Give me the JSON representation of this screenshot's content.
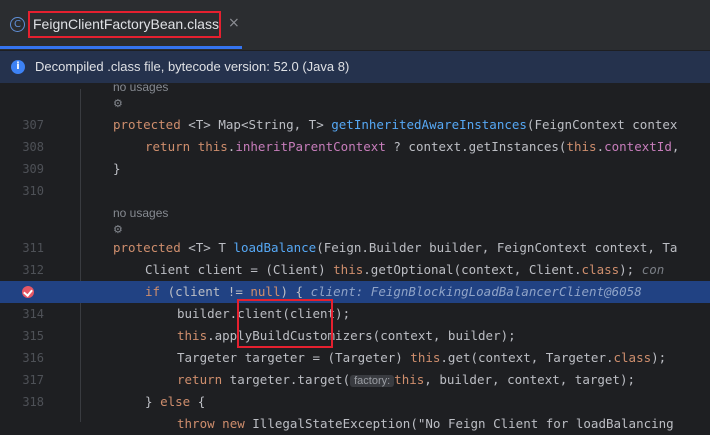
{
  "tab": {
    "icon": "class-icon",
    "title": "FeignClientFactoryBean.class",
    "close": "×"
  },
  "banner": {
    "icon": "info-icon",
    "text": "Decompiled .class file, bytecode version: 52.0 (Java 8)"
  },
  "editor": {
    "hints": {
      "usages1": "no usages",
      "usages2": "no usages"
    },
    "lines": {
      "l307": {
        "num": "307",
        "kw": "protected",
        "rest": " <T> Map<String, T> ",
        "fn": "getInheritedAwareInstances",
        "tail": "(FeignContext contex"
      },
      "l308": {
        "num": "308",
        "kw1": "return",
        "this1": "this",
        "p1": ".",
        "fld1": "inheritParentContext",
        "p2": " ? context.getInstances(",
        "this2": "this",
        "p3": ".",
        "fld2": "contextId",
        "p4": ","
      },
      "l309": {
        "num": "309",
        "text": "}"
      },
      "l310": {
        "num": "310"
      },
      "l311": {
        "num": "311",
        "kw": "protected",
        "rest": " <T> T ",
        "fn": "loadBalance",
        "tail": "(Feign.Builder builder, FeignContext context, Ta"
      },
      "l312": {
        "num": "312",
        "pre": "Client client = (Client) ",
        "this": "this",
        "mid": ".getOptional(context, Client.",
        "cls": "class",
        "end": ");",
        "inl": "con"
      },
      "l313": {
        "kw1": "if",
        "mid": " (client != ",
        "kw2": "null",
        "end": ") {",
        "inl": "client: FeignBlockingLoadBalancerClient@6058"
      },
      "l314": {
        "num": "314",
        "text": "builder.client(client);"
      },
      "l315": {
        "num": "315",
        "this": "this",
        "rest": ".applyBuildCustomizers(context, builder);"
      },
      "l316": {
        "num": "316",
        "pre": "Targeter targeter = (Targeter) ",
        "this": "this",
        "mid": ".get(context, Targeter.",
        "cls": "class",
        "end": ");"
      },
      "l317": {
        "num": "317",
        "kw": "return",
        "mid": " targeter.target(",
        "param": "factory:",
        "this": "this",
        "end": ", builder, context, target);"
      },
      "l318": {
        "num": "318",
        "pre": "} ",
        "kw": "else",
        "end": " {"
      },
      "l319": {
        "kw1": "throw",
        "kw2": "new",
        "rest": " IllegalStateException(\"No Feign Client for loadBalancing"
      }
    }
  }
}
